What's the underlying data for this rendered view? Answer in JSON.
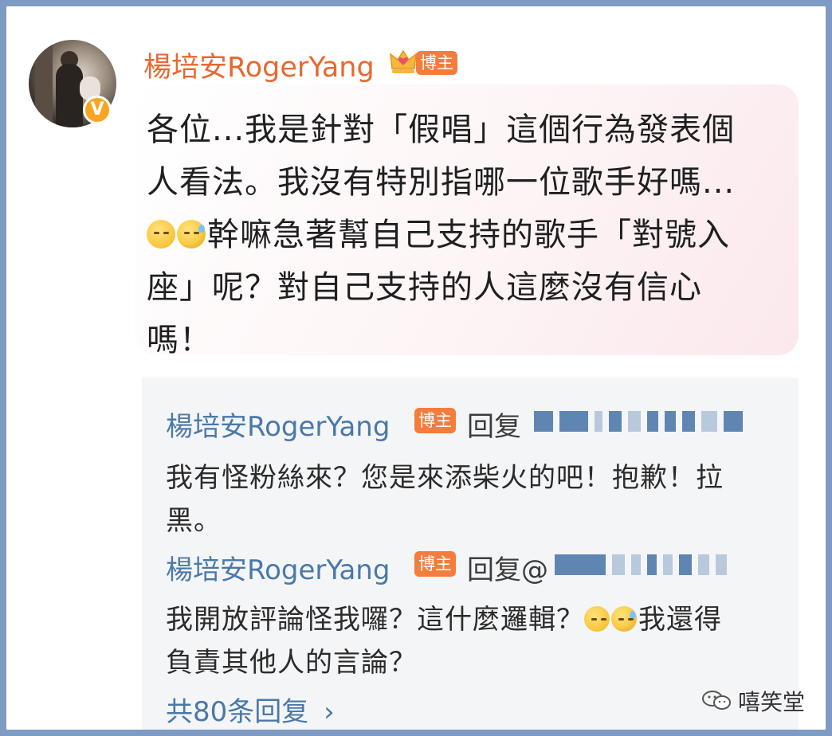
{
  "post": {
    "username": "楊培安RogerYang",
    "badge": "博主",
    "avatar_badge": "V",
    "content_lines": [
      "各位...我是針對「假唱」這個行為發表個",
      "人看法。我沒有特別指哪一位歌手好嗎...",
      "幹嘛急著幫自己支持的歌手「對號入",
      "座」呢？對自己支持的人這麼沒有信心",
      "嗎！"
    ],
    "emojis": [
      "smirk-emoji",
      "sweat-emoji"
    ]
  },
  "replies": [
    {
      "author": "楊培安RogerYang",
      "badge": "博主",
      "action": "回复",
      "target": "",
      "lines": [
        "我有怪粉絲來？您是來添柴火的吧！抱歉！拉",
        "黑。"
      ]
    },
    {
      "author": "楊培安RogerYang",
      "badge": "博主",
      "action": "回复",
      "target": "@",
      "lines": [
        "我開放評論怪我囉？這什麼邏輯？",
        "我還得",
        "負責其他人的言論？"
      ]
    }
  ],
  "more_replies": "共80条回复",
  "more_icon": "chevron-right-icon",
  "watermark": "嘻笑堂",
  "colors": {
    "username": "#e7692f",
    "reply_name": "#4a79a8",
    "badge": "#f47c3c",
    "border": "#7d9bc3"
  }
}
